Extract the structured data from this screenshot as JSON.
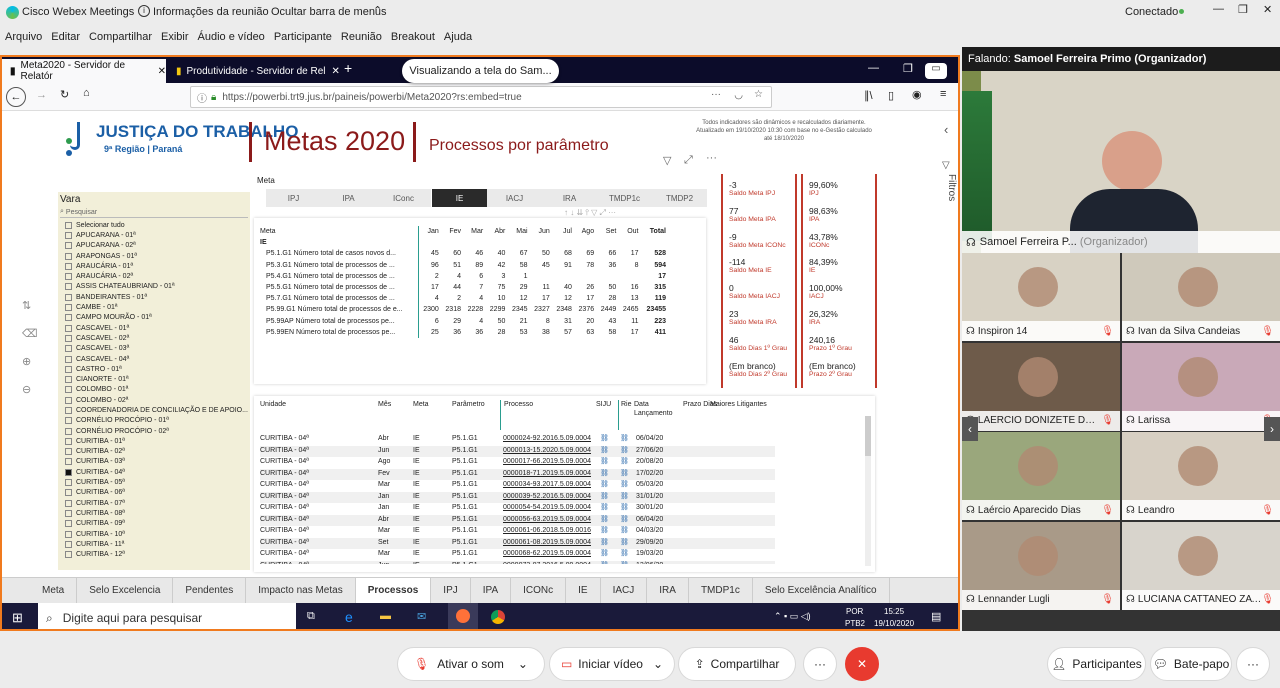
{
  "webex_top": {
    "app": "Cisco Webex Meetings",
    "info": "Informações da reunião",
    "hide": "Ocultar barra de menus",
    "status": "Conectado"
  },
  "webex_menu": [
    "Arquivo",
    "Editar",
    "Compartilhar",
    "Exibir",
    "Áudio e vídeo",
    "Participante",
    "Reunião",
    "Breakout",
    "Ajuda"
  ],
  "browser": {
    "tab1": "Meta2020 - Servidor de Relatór",
    "tab2": "Produtividade - Servidor de Rel",
    "sharing_banner": "Visualizando a tela do Sam...",
    "url": "https://powerbi.trt9.jus.br/paineis/powerbi/Meta2020?rs:embed=true"
  },
  "report": {
    "logo_title": "JUSTIÇA DO TRABALHO",
    "logo_sub": "9ª Região | Paraná",
    "title": "Metas 2020",
    "subtitle": "Processos por parâmetro",
    "note": "Todos indicadores são dinâmicos e recalculados diariamente. Atualizado em 19/10/2020 10:30 com base no e-Gestão calculado até 18/10/2020",
    "filtros": "Filtros",
    "meta_label": "Meta",
    "meta_buttons": [
      "IPJ",
      "IPA",
      "IConc",
      "IE",
      "IACJ",
      "IRA",
      "TMDP1c",
      "TMDP2"
    ],
    "vara": {
      "title": "Vara",
      "search": "Pesquisar",
      "items": [
        "Selecionar tudo",
        "APUCARANA - 01ª",
        "APUCARANA - 02ª",
        "ARAPONGAS - 01ª",
        "ARAUCÁRIA - 01ª",
        "ARAUCÁRIA - 02ª",
        "ASSIS CHATEAUBRIAND - 01ª",
        "BANDEIRANTES - 01ª",
        "CAMBE - 01ª",
        "CAMPO MOURÃO - 01ª",
        "CASCAVEL - 01ª",
        "CASCAVEL - 02ª",
        "CASCAVEL - 03ª",
        "CASCAVEL - 04ª",
        "CASTRO - 01ª",
        "CIANORTE - 01ª",
        "COLOMBO - 01ª",
        "COLOMBO - 02ª",
        "COORDENADORIA DE CONCILIAÇÃO E DE APOIO...",
        "CORNÉLIO PROCÓPIO - 01ª",
        "CORNÉLIO PROCÓPIO - 02ª",
        "CURITIBA - 01ª",
        "CURITIBA - 02ª",
        "CURITIBA - 03ª",
        "CURITIBA - 04ª",
        "CURITIBA - 05ª",
        "CURITIBA - 06ª",
        "CURITIBA - 07ª",
        "CURITIBA - 08ª",
        "CURITIBA - 09ª",
        "CURITIBA - 10ª",
        "CURITIBA - 11ª",
        "CURITIBA - 12ª"
      ]
    },
    "matrix": {
      "headers": [
        "Meta",
        "Jan",
        "Fev",
        "Mar",
        "Abr",
        "Mai",
        "Jun",
        "Jul",
        "Ago",
        "Set",
        "Out",
        "Total"
      ],
      "group": "IE",
      "rows": [
        [
          "P5.1.G1 Número total de casos novos d...",
          "45",
          "60",
          "46",
          "40",
          "67",
          "50",
          "68",
          "69",
          "66",
          "17",
          "528"
        ],
        [
          "P5.3.G1 Número total de processos de ...",
          "96",
          "51",
          "89",
          "42",
          "58",
          "45",
          "91",
          "78",
          "36",
          "8",
          "594"
        ],
        [
          "P5.4.G1 Número total de processos de ...",
          "2",
          "4",
          "6",
          "3",
          "1",
          "",
          "",
          "",
          "",
          "",
          "17"
        ],
        [
          "P5.5.G1 Número total de processos de ...",
          "17",
          "44",
          "7",
          "75",
          "29",
          "11",
          "40",
          "26",
          "50",
          "16",
          "315"
        ],
        [
          "P5.7.G1 Número total de processos de ...",
          "4",
          "2",
          "4",
          "10",
          "12",
          "17",
          "12",
          "17",
          "28",
          "13",
          "119"
        ],
        [
          "P5.99.G1 Número total de processos de e...",
          "2300",
          "2318",
          "2228",
          "2299",
          "2345",
          "2327",
          "2348",
          "2376",
          "2449",
          "2465",
          "23455"
        ],
        [
          "P5.99AP Número total de processos pe...",
          "6",
          "29",
          "4",
          "50",
          "21",
          "8",
          "31",
          "20",
          "43",
          "11",
          "223"
        ],
        [
          "P5.99EN Número total de processos pe...",
          "25",
          "36",
          "36",
          "28",
          "53",
          "38",
          "57",
          "63",
          "58",
          "17",
          "411"
        ]
      ]
    },
    "kpi_left": [
      {
        "value": "-3",
        "label": "Saldo Meta IPJ"
      },
      {
        "value": "77",
        "label": "Saldo Meta IPA"
      },
      {
        "value": "-9",
        "label": "Saldo Meta ICONc"
      },
      {
        "value": "-114",
        "label": "Saldo Meta IE"
      },
      {
        "value": "0",
        "label": "Saldo Meta IACJ"
      },
      {
        "value": "23",
        "label": "Saldo Meta IRA"
      },
      {
        "value": "46",
        "label": "Saldo Dias 1º Grau"
      },
      {
        "value": "(Em branco)",
        "label": "Saldo Dias 2º Grau"
      }
    ],
    "kpi_right": [
      {
        "value": "99,60%",
        "label": "IPJ"
      },
      {
        "value": "98,63%",
        "label": "IPA"
      },
      {
        "value": "43,78%",
        "label": "ICONc"
      },
      {
        "value": "84,39%",
        "label": "IE"
      },
      {
        "value": "100,00%",
        "label": "IACJ"
      },
      {
        "value": "26,32%",
        "label": "IRA"
      },
      {
        "value": "240,16",
        "label": "Prazo 1º Grau"
      },
      {
        "value": "(Em branco)",
        "label": "Prazo 2º Grau"
      }
    ],
    "detail": {
      "headers": [
        "Unidade",
        "Mês",
        "Meta",
        "Parâmetro",
        "Processo",
        "SIJU",
        "Rie",
        "Data Lançamento",
        "Prazo Dias",
        "Maiores Litigantes"
      ],
      "rows": [
        [
          "CURITIBA - 04ª",
          "Abr",
          "IE",
          "P5.1.G1",
          "0000024-92.2016.5.09.0004",
          "06/04/20"
        ],
        [
          "CURITIBA - 04ª",
          "Jun",
          "IE",
          "P5.1.G1",
          "0000013-15.2020.5.09.0004",
          "27/06/20"
        ],
        [
          "CURITIBA - 04ª",
          "Ago",
          "IE",
          "P5.1.G1",
          "0000017-66.2019.5.09.0004",
          "20/08/20"
        ],
        [
          "CURITIBA - 04ª",
          "Fev",
          "IE",
          "P5.1.G1",
          "0000018-71.2019.5.09.0004",
          "17/02/20"
        ],
        [
          "CURITIBA - 04ª",
          "Mar",
          "IE",
          "P5.1.G1",
          "0000034-93.2017.5.09.0004",
          "05/03/20"
        ],
        [
          "CURITIBA - 04ª",
          "Jan",
          "IE",
          "P5.1.G1",
          "0000039-52.2016.5.09.0004",
          "31/01/20"
        ],
        [
          "CURITIBA - 04ª",
          "Jan",
          "IE",
          "P5.1.G1",
          "0000054-54.2019.5.09.0004",
          "30/01/20"
        ],
        [
          "CURITIBA - 04ª",
          "Abr",
          "IE",
          "P5.1.G1",
          "0000056-63.2019.5.09.0004",
          "06/04/20"
        ],
        [
          "CURITIBA - 04ª",
          "Mar",
          "IE",
          "P5.1.G1",
          "0000061-06.2018.5.09.0016",
          "04/03/20"
        ],
        [
          "CURITIBA - 04ª",
          "Set",
          "IE",
          "P5.1.G1",
          "0000061-08.2019.5.09.0004",
          "29/09/20"
        ],
        [
          "CURITIBA - 04ª",
          "Mar",
          "IE",
          "P5.1.G1",
          "0000068-62.2019.5.09.0004",
          "19/03/20"
        ],
        [
          "CURITIBA - 04ª",
          "Jun",
          "IE",
          "P5.1.G1",
          "0000073-07.2016.5.09.0004",
          "12/06/20"
        ]
      ]
    },
    "page_tabs": [
      "Meta",
      "Selo Excelencia",
      "Pendentes",
      "Impacto nas Metas",
      "Processos",
      "IPJ",
      "IPA",
      "ICONc",
      "IE",
      "IACJ",
      "IRA",
      "TMDP1c",
      "Selo Excelência Analítico"
    ]
  },
  "taskbar": {
    "search": "Digite aqui para pesquisar",
    "lang1": "POR",
    "lang2": "PTB2",
    "time": "15:25",
    "date": "19/10/2020"
  },
  "speaker": {
    "label": "Falando:",
    "name": "Samoel Ferreira Primo (Organizador)",
    "tile_name": "Samoel Ferreira P...",
    "tile_role": "(Organizador)"
  },
  "participants": [
    "Inspiron 14",
    "Ivan da Silva Candeias",
    "LAERCIO DONIZETE DEL ...",
    "Larissa",
    "Laércio Aparecido Dias",
    "Leandro",
    "Lennander Lugli",
    "LUCIANA CATTANEO ZAV..."
  ],
  "controls": {
    "mute": "Ativar o som",
    "video": "Iniciar vídeo",
    "share": "Compartilhar",
    "participants": "Participantes",
    "chat": "Bate-papo"
  },
  "colors": {
    "accent": "#f07a1e",
    "brand_red": "#8b1a1a",
    "kpi_red": "#c0392b",
    "end_call": "#e83a2f",
    "vara_bg": "#f2efd9"
  }
}
